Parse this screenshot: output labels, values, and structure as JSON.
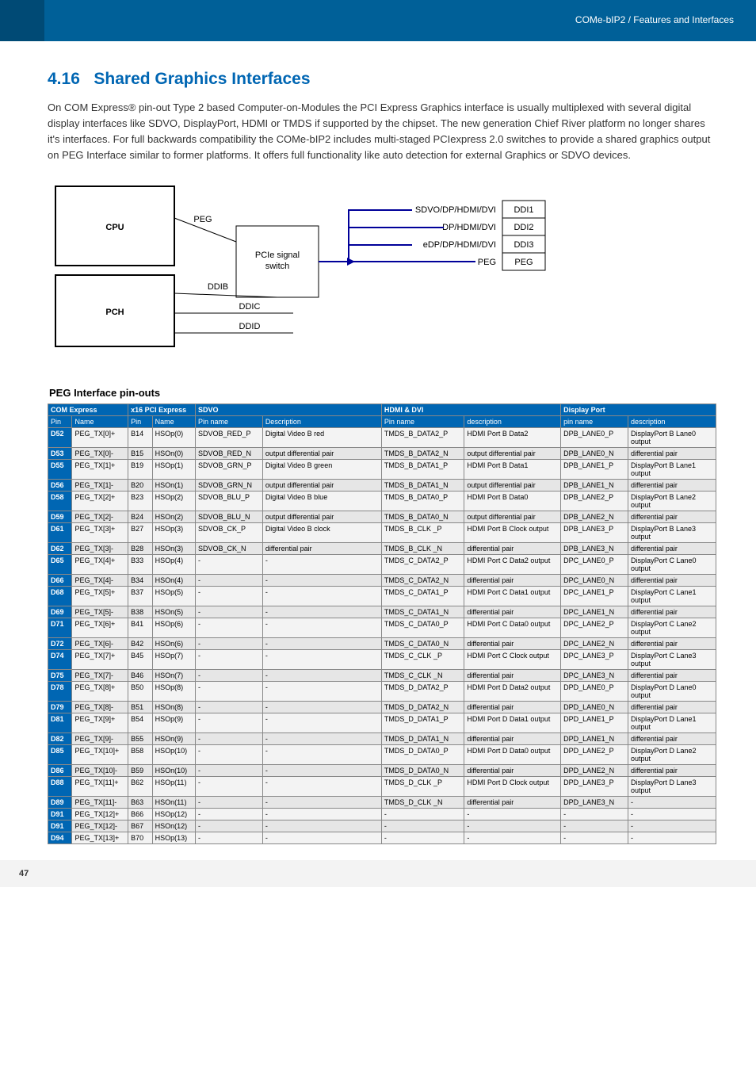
{
  "header": {
    "crumb": "COMe-bIP2 / Features and Interfaces"
  },
  "title": {
    "num": "4.16",
    "text": "Shared Graphics Interfaces"
  },
  "intro": "On COM Express® pin-out Type 2 based Computer-on-Modules the PCI Express Graphics interface is usually multiplexed with several digital display interfaces like SDVO, DisplayPort, HDMI or TMDS if supported by the chipset. The new generation Chief River platform no longer shares it's interfaces. For full backwards compatibility the COMe-bIP2 includes multi-staged PCIexpress 2.0 switches to provide a shared graphics output on PEG Interface similar to former platforms. It offers full functionality like auto detection for external Graphics or SDVO devices.",
  "diagram": {
    "cpu": "CPU",
    "pch": "PCH",
    "switch": "PCIe signal\nswitch",
    "peg": "PEG",
    "ddib": "DDIB",
    "ddic": "DDIC",
    "ddid": "DDID",
    "lines": [
      "SDVO/DP/HDMI/DVI",
      "DP/HDMI/DVI",
      "eDP/DP/HDMI/DVI",
      "PEG"
    ],
    "conn": [
      "DDI1",
      "DDI2",
      "DDI3",
      "PEG"
    ]
  },
  "subhead": "PEG Interface pin-outs",
  "groups": [
    {
      "label": "COM Express",
      "span": 2
    },
    {
      "label": "x16 PCI Express",
      "span": 2
    },
    {
      "label": "SDVO",
      "span": 2
    },
    {
      "label": "HDMI & DVI",
      "span": 2
    },
    {
      "label": "Display Port",
      "span": 2
    }
  ],
  "cols": [
    "Pin",
    "Name",
    "Pin",
    "Name",
    "Pin name",
    "Description",
    "Pin name",
    "description",
    "pin name",
    "description"
  ],
  "colw": [
    "28",
    "65",
    "28",
    "50",
    "78",
    "138",
    "96",
    "112",
    "78",
    "102"
  ],
  "rows": [
    [
      "D52",
      "PEG_TX[0]+",
      "B14",
      "HSOp(0)",
      "SDVOB_RED_P",
      "Digital Video B red",
      "TMDS_B_DATA2_P",
      "HDMI Port B Data2",
      "DPB_LANE0_P",
      "DisplayPort B Lane0 output"
    ],
    [
      "D53",
      "PEG_TX[0]-",
      "B15",
      "HSOn(0)",
      "SDVOB_RED_N",
      "output differential pair",
      "TMDS_B_DATA2_N",
      "output differential pair",
      "DPB_LANE0_N",
      "differential pair"
    ],
    [
      "D55",
      "PEG_TX[1]+",
      "B19",
      "HSOp(1)",
      "SDVOB_GRN_P",
      "Digital Video B green",
      "TMDS_B_DATA1_P",
      "HDMI Port B Data1",
      "DPB_LANE1_P",
      "DisplayPort B Lane1 output"
    ],
    [
      "D56",
      "PEG_TX[1]-",
      "B20",
      "HSOn(1)",
      "SDVOB_GRN_N",
      "output differential pair",
      "TMDS_B_DATA1_N",
      "output differential pair",
      "DPB_LANE1_N",
      "differential pair"
    ],
    [
      "D58",
      "PEG_TX[2]+",
      "B23",
      "HSOp(2)",
      "SDVOB_BLU_P",
      "Digital Video B blue",
      "TMDS_B_DATA0_P",
      "HDMI Port B Data0",
      "DPB_LANE2_P",
      "DisplayPort B Lane2 output"
    ],
    [
      "D59",
      "PEG_TX[2]-",
      "B24",
      "HSOn(2)",
      "SDVOB_BLU_N",
      "output differential pair",
      "TMDS_B_DATA0_N",
      "output differential pair",
      "DPB_LANE2_N",
      "differential pair"
    ],
    [
      "D61",
      "PEG_TX[3]+",
      "B27",
      "HSOp(3)",
      "SDVOB_CK_P",
      "Digital Video B clock",
      "TMDS_B_CLK _P",
      "HDMI Port B Clock output",
      "DPB_LANE3_P",
      "DisplayPort B Lane3 output"
    ],
    [
      "D62",
      "PEG_TX[3]-",
      "B28",
      "HSOn(3)",
      "SDVOB_CK_N",
      "differential pair",
      "TMDS_B_CLK _N",
      "differential pair",
      "DPB_LANE3_N",
      "differential pair"
    ],
    [
      "D65",
      "PEG_TX[4]+",
      "B33",
      "HSOp(4)",
      "-",
      "-",
      "TMDS_C_DATA2_P",
      "HDMI Port C Data2 output",
      "DPC_LANE0_P",
      "DisplayPort C Lane0 output"
    ],
    [
      "D66",
      "PEG_TX[4]-",
      "B34",
      "HSOn(4)",
      "-",
      "-",
      "TMDS_C_DATA2_N",
      "differential pair",
      "DPC_LANE0_N",
      "differential pair"
    ],
    [
      "D68",
      "PEG_TX[5]+",
      "B37",
      "HSOp(5)",
      "-",
      "-",
      "TMDS_C_DATA1_P",
      "HDMI Port C Data1 output",
      "DPC_LANE1_P",
      "DisplayPort C Lane1 output"
    ],
    [
      "D69",
      "PEG_TX[5]-",
      "B38",
      "HSOn(5)",
      "-",
      "-",
      "TMDS_C_DATA1_N",
      "differential pair",
      "DPC_LANE1_N",
      "differential pair"
    ],
    [
      "D71",
      "PEG_TX[6]+",
      "B41",
      "HSOp(6)",
      "-",
      "-",
      "TMDS_C_DATA0_P",
      "HDMI Port C Data0 output",
      "DPC_LANE2_P",
      "DisplayPort C Lane2 output"
    ],
    [
      "D72",
      "PEG_TX[6]-",
      "B42",
      "HSOn(6)",
      "-",
      "-",
      "TMDS_C_DATA0_N",
      "differential pair",
      "DPC_LANE2_N",
      "differential pair"
    ],
    [
      "D74",
      "PEG_TX[7]+",
      "B45",
      "HSOp(7)",
      "-",
      "-",
      "TMDS_C_CLK _P",
      "HDMI Port C Clock output",
      "DPC_LANE3_P",
      "DisplayPort C Lane3 output"
    ],
    [
      "D75",
      "PEG_TX[7]-",
      "B46",
      "HSOn(7)",
      "-",
      "-",
      "TMDS_C_CLK _N",
      "differential pair",
      "DPC_LANE3_N",
      "differential pair"
    ],
    [
      "D78",
      "PEG_TX[8]+",
      "B50",
      "HSOp(8)",
      "-",
      "-",
      "TMDS_D_DATA2_P",
      "HDMI Port D Data2 output",
      "DPD_LANE0_P",
      "DisplayPort D Lane0 output"
    ],
    [
      "D79",
      "PEG_TX[8]-",
      "B51",
      "HSOn(8)",
      "-",
      "-",
      "TMDS_D_DATA2_N",
      "differential pair",
      "DPD_LANE0_N",
      "differential pair"
    ],
    [
      "D81",
      "PEG_TX[9]+",
      "B54",
      "HSOp(9)",
      "-",
      "-",
      "TMDS_D_DATA1_P",
      "HDMI Port D Data1 output",
      "DPD_LANE1_P",
      "DisplayPort D Lane1 output"
    ],
    [
      "D82",
      "PEG_TX[9]-",
      "B55",
      "HSOn(9)",
      "-",
      "-",
      "TMDS_D_DATA1_N",
      "differential pair",
      "DPD_LANE1_N",
      "differential pair"
    ],
    [
      "D85",
      "PEG_TX[10]+",
      "B58",
      "HSOp(10)",
      "-",
      "-",
      "TMDS_D_DATA0_P",
      "HDMI Port D Data0 output",
      "DPD_LANE2_P",
      "DisplayPort D Lane2 output"
    ],
    [
      "D86",
      "PEG_TX[10]-",
      "B59",
      "HSOn(10)",
      "-",
      "-",
      "TMDS_D_DATA0_N",
      "differential pair",
      "DPD_LANE2_N",
      "differential pair"
    ],
    [
      "D88",
      "PEG_TX[11]+",
      "B62",
      "HSOp(11)",
      "-",
      "-",
      "TMDS_D_CLK _P",
      "HDMI Port D Clock output",
      "DPD_LANE3_P",
      "DisplayPort D Lane3 output"
    ],
    [
      "D89",
      "PEG_TX[11]-",
      "B63",
      "HSOn(11)",
      "-",
      "-",
      "TMDS_D_CLK _N",
      "differential pair",
      "DPD_LANE3_N",
      "-"
    ],
    [
      "D91",
      "PEG_TX[12]+",
      "B66",
      "HSOp(12)",
      "-",
      "-",
      "-",
      "-",
      "-",
      "-"
    ],
    [
      "D91",
      "PEG_TX[12]-",
      "B67",
      "HSOn(12)",
      "-",
      "-",
      "-",
      "-",
      "-",
      "-"
    ],
    [
      "D94",
      "PEG_TX[13]+",
      "B70",
      "HSOp(13)",
      "-",
      "-",
      "-",
      "-",
      "-",
      "-"
    ]
  ],
  "footer": {
    "page": "47"
  }
}
